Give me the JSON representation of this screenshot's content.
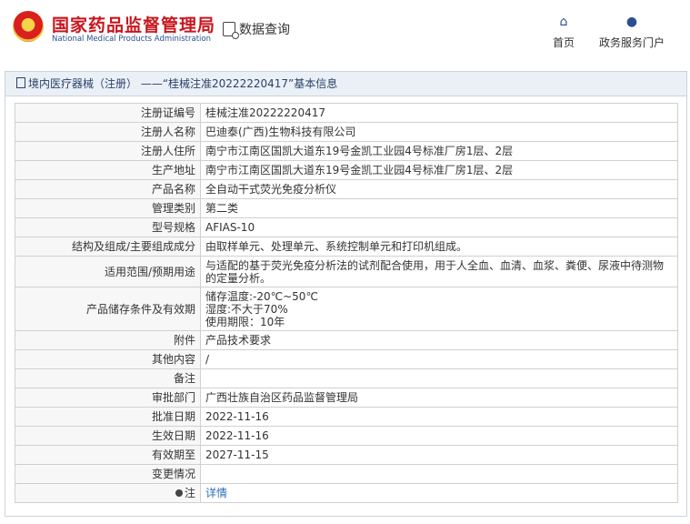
{
  "header": {
    "org_name_cn": "国家药品监督管理局",
    "org_name_en": "National Medical Products Administration",
    "query_label": "数据查询",
    "nav": [
      {
        "label": "首页",
        "icon": "home-icon"
      },
      {
        "label": "政务服务门户",
        "icon": "user-icon"
      }
    ]
  },
  "panel": {
    "title": "境内医疗器械（注册） ——“桂械注准20222220417”基本信息"
  },
  "details": {
    "reg_no": {
      "label": "注册证编号",
      "value": "桂械注准20222220417"
    },
    "registrant": {
      "label": "注册人名称",
      "value": "巴迪泰(广西)生物科技有限公司"
    },
    "address": {
      "label": "注册人住所",
      "value": "南宁市江南区国凯大道东19号金凯工业园4号标准厂房1层、2层"
    },
    "prod_address": {
      "label": "生产地址",
      "value": "南宁市江南区国凯大道东19号金凯工业园4号标准厂房1层、2层"
    },
    "product_name": {
      "label": "产品名称",
      "value": "全自动干式荧光免疫分析仪"
    },
    "category": {
      "label": "管理类别",
      "value": "第二类"
    },
    "model": {
      "label": "型号规格",
      "value": "AFIAS-10"
    },
    "structure": {
      "label": "结构及组成/主要组成成分",
      "value": "由取样单元、处理单元、系统控制单元和打印机组成。"
    },
    "scope": {
      "label": "适用范围/预期用途",
      "value": "与适配的基于荧光免疫分析法的试剂配合使用，用于人全血、血清、血浆、粪便、尿液中待测物的定量分析。"
    },
    "storage": {
      "label": "产品储存条件及有效期",
      "lines": [
        "储存温度:-20℃~50℃",
        "湿度:不大于70%",
        "使用期限：10年"
      ]
    },
    "attachment": {
      "label": "附件",
      "value": "产品技术要求"
    },
    "other": {
      "label": "其他内容",
      "value": "/"
    },
    "remark": {
      "label": "备注",
      "value": ""
    },
    "approver": {
      "label": "审批部门",
      "value": "广西壮族自治区药品监督管理局"
    },
    "approval_date": {
      "label": "批准日期",
      "value": "2022-11-16"
    },
    "effective_date": {
      "label": "生效日期",
      "value": "2022-11-16"
    },
    "valid_until": {
      "label": "有效期至",
      "value": "2027-11-15"
    },
    "changes": {
      "label": "变更情况",
      "value": ""
    },
    "note": {
      "label": "注",
      "link": "详情"
    }
  }
}
